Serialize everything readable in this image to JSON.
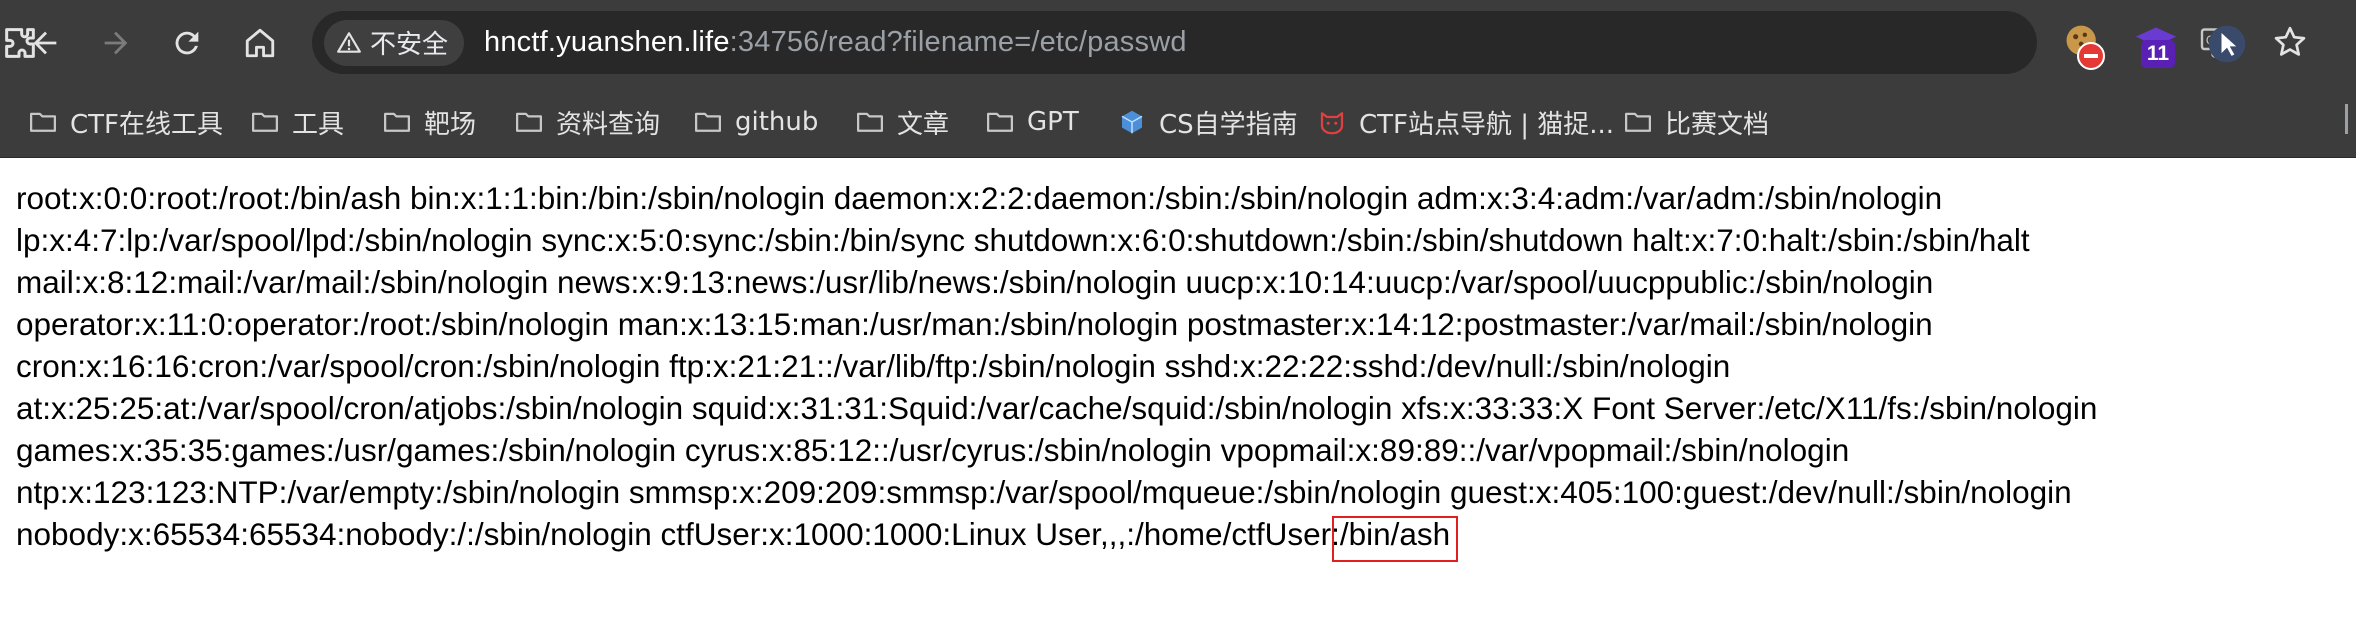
{
  "toolbar": {
    "security_label": "不安全",
    "url_host": "hnctf.yuanshen.life",
    "url_rest": ":34756/read?filename=/etc/passwd",
    "extension_badge": "11"
  },
  "icons": {
    "back": "arrow-left-icon",
    "forward": "arrow-right-icon",
    "reload": "reload-icon",
    "home": "home-icon",
    "warning": "warning-triangle-icon",
    "translate": "translate-icon",
    "bookmark": "star-icon",
    "folder": "folder-icon",
    "extensions": "puzzle-icon"
  },
  "bookmarks": [
    {
      "label": "CTF在线工具",
      "type": "folder"
    },
    {
      "label": "工具",
      "type": "folder"
    },
    {
      "label": "靶场",
      "type": "folder"
    },
    {
      "label": "资料查询",
      "type": "folder"
    },
    {
      "label": "github",
      "type": "folder"
    },
    {
      "label": "文章",
      "type": "folder"
    },
    {
      "label": "GPT",
      "type": "folder"
    },
    {
      "label": "CS自学指南",
      "type": "site"
    },
    {
      "label": "CTF站点导航 | 猫捉...",
      "type": "site"
    },
    {
      "label": "比赛文档",
      "type": "folder"
    }
  ],
  "content": {
    "lines": [
      "root:x:0:0:root:/root:/bin/ash bin:x:1:1:bin:/bin:/sbin/nologin daemon:x:2:2:daemon:/sbin:/sbin/nologin adm:x:3:4:adm:/var/adm:/sbin/nologin",
      "lp:x:4:7:lp:/var/spool/lpd:/sbin/nologin sync:x:5:0:sync:/sbin:/bin/sync shutdown:x:6:0:shutdown:/sbin:/sbin/shutdown halt:x:7:0:halt:/sbin:/sbin/halt",
      "mail:x:8:12:mail:/var/mail:/sbin/nologin news:x:9:13:news:/usr/lib/news:/sbin/nologin uucp:x:10:14:uucp:/var/spool/uucppublic:/sbin/nologin",
      "operator:x:11:0:operator:/root:/sbin/nologin man:x:13:15:man:/usr/man:/sbin/nologin postmaster:x:14:12:postmaster:/var/mail:/sbin/nologin",
      "cron:x:16:16:cron:/var/spool/cron:/sbin/nologin ftp:x:21:21::/var/lib/ftp:/sbin/nologin sshd:x:22:22:sshd:/dev/null:/sbin/nologin",
      "at:x:25:25:at:/var/spool/cron/atjobs:/sbin/nologin squid:x:31:31:Squid:/var/cache/squid:/sbin/nologin xfs:x:33:33:X Font Server:/etc/X11/fs:/sbin/nologin",
      "games:x:35:35:games:/usr/games:/sbin/nologin cyrus:x:85:12::/usr/cyrus:/sbin/nologin vpopmail:x:89:89::/var/vpopmail:/sbin/nologin",
      "ntp:x:123:123:NTP:/var/empty:/sbin/nologin smmsp:x:209:209:smmsp:/var/spool/mqueue:/sbin/nologin guest:x:405:100:guest:/dev/null:/sbin/nologin",
      "nobody:x:65534:65534:nobody:/:/sbin/nologin ctfUser:x:1000:1000:Linux User,,,:/home/ctfUser:/bin/ash"
    ]
  },
  "colors": {
    "toolbar_bg": "#3c3c3c",
    "omnibox_bg": "#282828",
    "highlight": "#e0201f"
  }
}
